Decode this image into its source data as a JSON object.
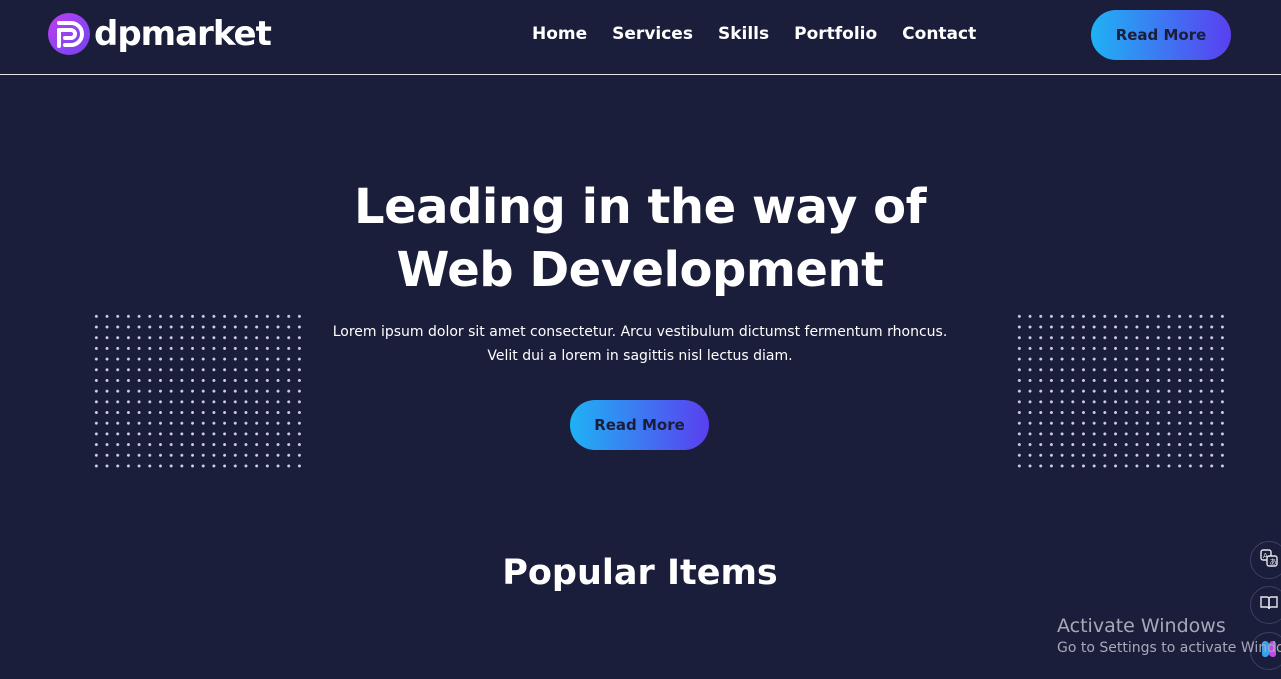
{
  "brand": {
    "name": "dpmarket"
  },
  "nav": {
    "items": [
      "Home",
      "Services",
      "Skills",
      "Portfolio",
      "Contact"
    ]
  },
  "header": {
    "cta_label": "Read More"
  },
  "hero": {
    "title_line1": "Leading in the way of",
    "title_line2": "Web Development",
    "subtitle_line1": "Lorem ipsum dolor sit amet consectetur. Arcu vestibulum dictumst fermentum rhoncus.",
    "subtitle_line2": "Velit dui a lorem in sagittis nisl lectus diam.",
    "cta_label": "Read More"
  },
  "popular": {
    "title": "Popular Items"
  },
  "watermark": {
    "title": "Activate Windows",
    "subtitle": "Go to Settings to activate Windows."
  },
  "colors": {
    "background": "#1b1e3a",
    "accent_start": "#1fb2f4",
    "accent_end": "#5a3ff0",
    "logo": "#c23bf2"
  },
  "icons": {
    "logo": "dp-logo-icon",
    "side_1": "translate-icon",
    "side_2": "reader-icon",
    "side_3": "copilot-icon"
  }
}
